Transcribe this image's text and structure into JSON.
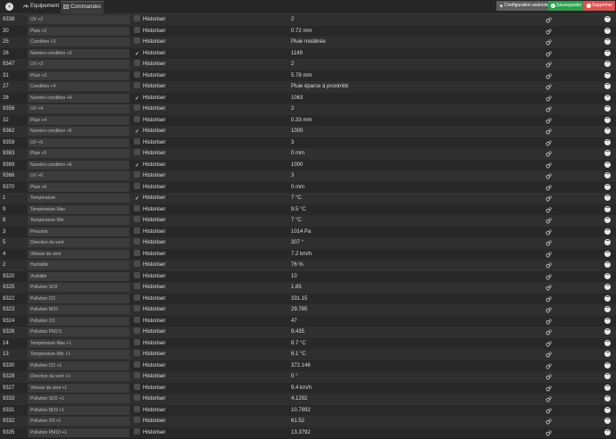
{
  "header": {
    "back_icon": "circle-arrow-left-icon",
    "tabs": [
      {
        "label": "Equipement",
        "icon": "tachometer-icon",
        "active": false
      },
      {
        "label": "Commandes",
        "icon": "list-icon",
        "active": true
      }
    ],
    "buttons": {
      "config": {
        "label": "Configuration avancée",
        "color": "#5e5e5e",
        "icon": "gears-icon"
      },
      "save": {
        "label": "Sauvegarder",
        "color": "#2e9e4f",
        "icon": "check-icon"
      },
      "delete": {
        "label": "Supprimer",
        "color": "#d9534f",
        "icon": "minus-icon"
      }
    }
  },
  "colors": {
    "check": "#ffffff",
    "background": "#2c2c2c"
  },
  "commands": [
    {
      "id": "9338",
      "name": "UV +2",
      "historize": false,
      "value": "2"
    },
    {
      "id": "30",
      "name": "Pluie +2",
      "historize": false,
      "value": "0.72 mm"
    },
    {
      "id": "25",
      "name": "Condition +3",
      "historize": false,
      "value": "Pluie modérée"
    },
    {
      "id": "26",
      "name": "Numéro condition +3",
      "historize": true,
      "value": "1189"
    },
    {
      "id": "9347",
      "name": "UV +3",
      "historize": false,
      "value": "2"
    },
    {
      "id": "31",
      "name": "Pluie +3",
      "historize": false,
      "value": "5.78 mm"
    },
    {
      "id": "27",
      "name": "Condition +4",
      "historize": false,
      "value": "Pluie éparse à proximité"
    },
    {
      "id": "28",
      "name": "Numéro condition +4",
      "historize": true,
      "value": "1063"
    },
    {
      "id": "9356",
      "name": "UV +4",
      "historize": false,
      "value": "2"
    },
    {
      "id": "32",
      "name": "Pluie +4",
      "historize": false,
      "value": "0.33 mm"
    },
    {
      "id": "9362",
      "name": "Numéro condition +5",
      "historize": true,
      "value": "1000"
    },
    {
      "id": "9359",
      "name": "UV +5",
      "historize": false,
      "value": "3"
    },
    {
      "id": "9363",
      "name": "Pluie +5",
      "historize": false,
      "value": "0 mm"
    },
    {
      "id": "9369",
      "name": "Numéro condition +6",
      "historize": true,
      "value": "1000"
    },
    {
      "id": "9366",
      "name": "UV +6",
      "historize": false,
      "value": "3"
    },
    {
      "id": "9370",
      "name": "Pluie +6",
      "historize": false,
      "value": "0 mm"
    },
    {
      "id": "1",
      "name": "Température",
      "historize": true,
      "value": "7 °C"
    },
    {
      "id": "9",
      "name": "Température Max",
      "historize": false,
      "value": "9.5 °C"
    },
    {
      "id": "8",
      "name": "Température Min",
      "historize": false,
      "value": "7 °C"
    },
    {
      "id": "3",
      "name": "Pression",
      "historize": false,
      "value": "1014 Pa"
    },
    {
      "id": "5",
      "name": "Direction du vent",
      "historize": false,
      "value": "307 °"
    },
    {
      "id": "4",
      "name": "Vitesse du vent",
      "historize": false,
      "value": "7.2 km/h"
    },
    {
      "id": "2",
      "name": "Humidité",
      "historize": false,
      "value": "76 %"
    },
    {
      "id": "9320",
      "name": "Visibilité",
      "historize": false,
      "value": "10"
    },
    {
      "id": "9325",
      "name": "Pollution SO2",
      "historize": false,
      "value": "1.85"
    },
    {
      "id": "9322",
      "name": "Pollution CO",
      "historize": false,
      "value": "331.15"
    },
    {
      "id": "9323",
      "name": "Pollution NO2",
      "historize": false,
      "value": "29.785"
    },
    {
      "id": "9324",
      "name": "Pollution O3",
      "historize": false,
      "value": "47"
    },
    {
      "id": "9326",
      "name": "Pollution PM2.5",
      "historize": false,
      "value": "9.435"
    },
    {
      "id": "14",
      "name": "Température Max +1",
      "historize": false,
      "value": "8.7 °C"
    },
    {
      "id": "13",
      "name": "Température Min +1",
      "historize": false,
      "value": "6.1 °C"
    },
    {
      "id": "9330",
      "name": "Pollution CO +1",
      "historize": false,
      "value": "372.146"
    },
    {
      "id": "9328",
      "name": "Direction du vent +1",
      "historize": false,
      "value": "0 °"
    },
    {
      "id": "9327",
      "name": "Vitesse du vent +1",
      "historize": false,
      "value": "9.4 km/h"
    },
    {
      "id": "9333",
      "name": "Pollution SO2 +1",
      "historize": false,
      "value": "4.1292"
    },
    {
      "id": "9331",
      "name": "Pollution NO2 +1",
      "historize": false,
      "value": "10.7892"
    },
    {
      "id": "9332",
      "name": "Pollution O3 +1",
      "historize": false,
      "value": "61.52"
    },
    {
      "id": "9335",
      "name": "Pollution PM10 +1",
      "historize": false,
      "value": "13.3792"
    }
  ],
  "historize_label": "Historiser"
}
